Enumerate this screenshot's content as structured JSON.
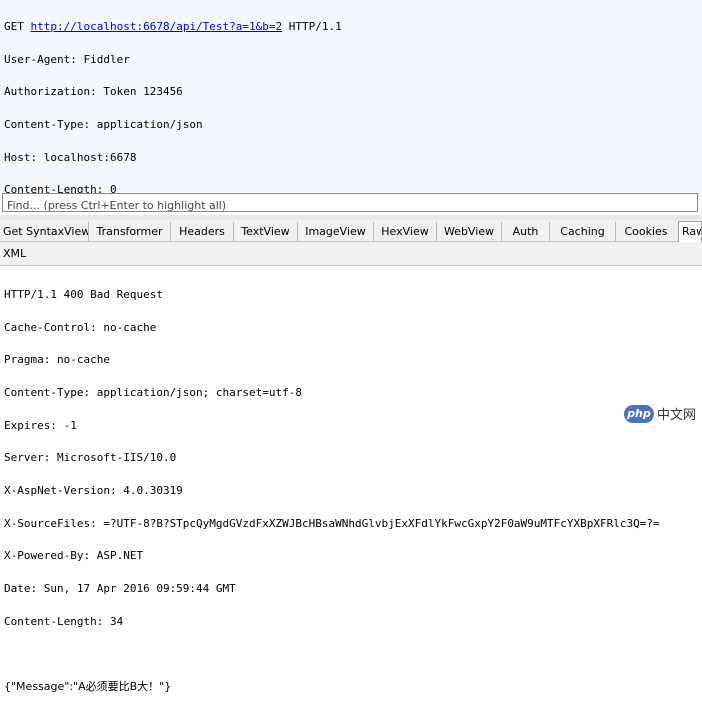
{
  "request": {
    "method": "GET",
    "url": "http://localhost:6678/api/Test?a=1&b=2",
    "protocol": "HTTP/1.1",
    "headers": [
      "User-Agent: Fiddler",
      "Authorization: Token 123456",
      "Content-Type: application/json",
      "Host: localhost:6678",
      "Content-Length: 0"
    ]
  },
  "find_bar": {
    "placeholder": "Find... (press Ctrl+Enter to highlight all)"
  },
  "tabs": [
    "Get SyntaxView",
    "Transformer",
    "Headers",
    "TextView",
    "ImageView",
    "HexView",
    "WebView",
    "Auth",
    "Caching",
    "Cookies",
    "Raw"
  ],
  "xml_tab": "XML",
  "response": {
    "lines": [
      "HTTP/1.1 400 Bad Request",
      "Cache-Control: no-cache",
      "Pragma: no-cache",
      "Content-Type: application/json; charset=utf-8",
      "Expires: -1",
      "Server: Microsoft-IIS/10.0",
      "X-AspNet-Version: 4.0.30319",
      "X-SourceFiles: =?UTF-8?B?STpcQyMgdGVzdFxXZWJBcHBsaWNhdGlvbjExXFdlYkFwcGxpY2F0aW9uMTFcYXBpXFRlc3Q=?=",
      "X-Powered-By: ASP.NET",
      "Date: Sun, 17 Apr 2016 09:59:44 GMT",
      "Content-Length: 34"
    ],
    "body": "{\"Message\":\"A必须要比B大！\"}"
  },
  "watermark": {
    "logo": "php",
    "text": "中文网"
  }
}
